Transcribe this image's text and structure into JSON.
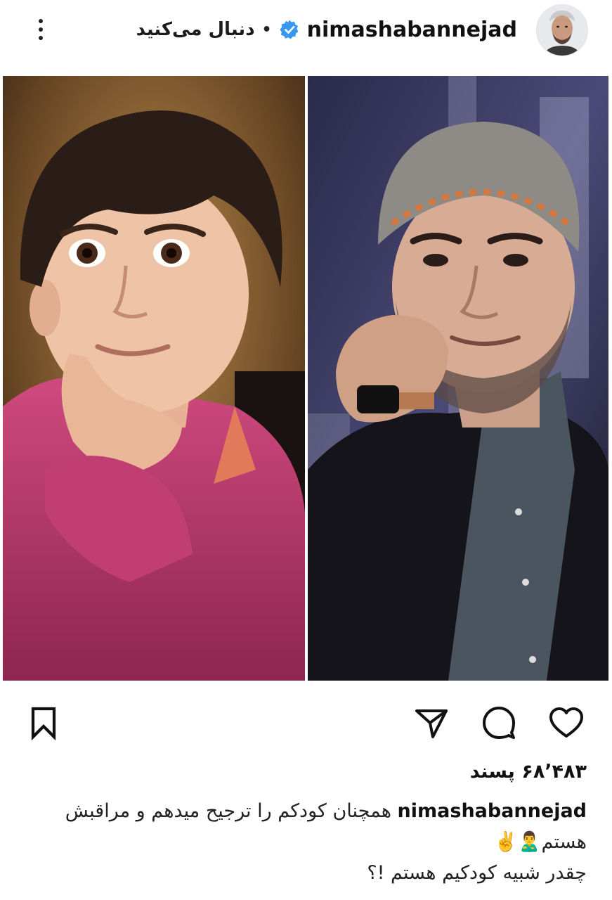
{
  "header": {
    "username": "nimashabannejad",
    "follow_label": "دنبال می‌کنید",
    "separator": "•",
    "verified_icon": "verified-badge-icon",
    "more_icon": "more-vertical-icon",
    "avatar_icon": "profile-avatar"
  },
  "post": {
    "image_left_description_icon": "childhood-photo",
    "image_right_description_icon": "adult-photo"
  },
  "actions": {
    "save_icon": "bookmark-icon",
    "share_icon": "send-icon",
    "comment_icon": "comment-icon",
    "like_icon": "heart-icon"
  },
  "caption": {
    "likes": "۶۸٬۴۸۳ پسند",
    "username": "nimashabannejad",
    "line1": "همچنان کودکم را ترجیح میدهم و مراقبش",
    "line2": "هستم🙎‍♂️✌️",
    "line3": "چقدر شبیه کودکیم هستم !؟"
  },
  "colors": {
    "verified": "#3897f0",
    "text": "#111111",
    "background": "#ffffff"
  }
}
